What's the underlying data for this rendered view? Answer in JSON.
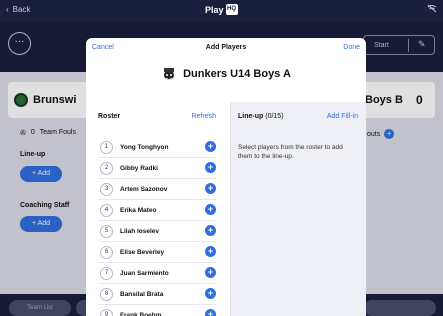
{
  "topbar": {
    "back_label": "Back",
    "app_name": "Play",
    "app_badge": "HQ"
  },
  "background": {
    "more_label": "···",
    "start_label": "Start",
    "team_left": "Brunswi",
    "team_right": "Boys B",
    "score_right": "0",
    "fouls_count": "0",
    "fouls_label": "Team Fouls",
    "lineup_label": "Line-up",
    "add_label": "+ Add",
    "coaching_label": "Coaching Staff",
    "outs_label": "outs",
    "chip_label": "Team List"
  },
  "modal": {
    "cancel_label": "Cancel",
    "title": "Add Players",
    "done_label": "Done",
    "team_name": "Dunkers U14 Boys A",
    "roster": {
      "heading": "Roster",
      "refresh_label": "Refresh",
      "players": [
        {
          "number": "1",
          "name": "Yong Tonghyon"
        },
        {
          "number": "2",
          "name": "Gibby Radki"
        },
        {
          "number": "3",
          "name": "Artem Sazonov"
        },
        {
          "number": "4",
          "name": "Erika Mateo"
        },
        {
          "number": "5",
          "name": "Lilah Ioselev"
        },
        {
          "number": "6",
          "name": "Elise Beverley"
        },
        {
          "number": "7",
          "name": "Juan Sarmiento"
        },
        {
          "number": "8",
          "name": "Bansilal Brata"
        },
        {
          "number": "9",
          "name": "Frank Boehm"
        }
      ]
    },
    "lineup": {
      "heading": "Line-up",
      "count": "(0/15)",
      "fillin_label": "Add Fill-in",
      "help_text": "Select players from the roster to add them to the line-up."
    }
  },
  "colors": {
    "accent": "#2f6fe0",
    "navy": "#1b1f3e"
  }
}
